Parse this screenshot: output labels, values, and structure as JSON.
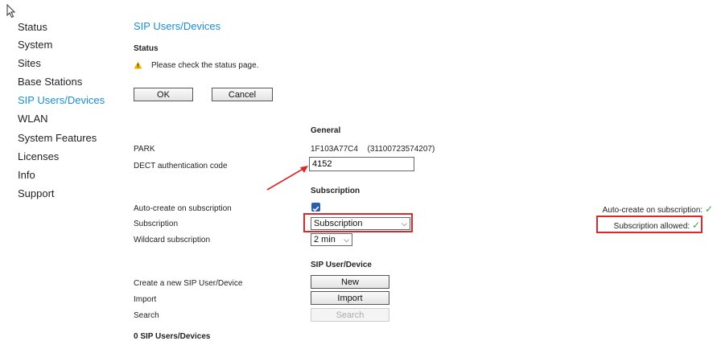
{
  "nav": {
    "items": [
      {
        "label": "Status"
      },
      {
        "label": "System"
      },
      {
        "label": "Sites"
      },
      {
        "label": "Base Stations"
      },
      {
        "label": "SIP Users/Devices"
      },
      {
        "label": "WLAN"
      },
      {
        "label": "System Features"
      },
      {
        "label": "Licenses"
      },
      {
        "label": "Info"
      },
      {
        "label": "Support"
      }
    ]
  },
  "page": {
    "title": "SIP Users/Devices",
    "status_heading": "Status",
    "status_message": "Please check the status page.",
    "ok_label": "OK",
    "cancel_label": "Cancel"
  },
  "general": {
    "heading": "General",
    "park_label": "PARK",
    "park_value": "1F103A77C4",
    "park_number": "(31100723574207)",
    "dect_label": "DECT authentication code",
    "dect_value": "4152"
  },
  "subscription": {
    "heading": "Subscription",
    "auto_create_label": "Auto-create on subscription",
    "auto_create_checked": true,
    "subscription_label": "Subscription",
    "subscription_value": "Subscription",
    "wildcard_label": "Wildcard subscription",
    "wildcard_value": "2 min",
    "status_auto_create": "Auto-create on subscription:",
    "status_allowed": "Subscription allowed:"
  },
  "sip": {
    "heading": "SIP User/Device",
    "create_label": "Create a new SIP User/Device",
    "new_button": "New",
    "import_label": "Import",
    "import_button": "Import",
    "search_label": "Search",
    "search_button": "Search",
    "count_text": "0 SIP Users/Devices"
  },
  "colors": {
    "link_active": "#1a8ed1",
    "title": "#1a8ed1",
    "highlight": "#d9292b",
    "ok_check": "#3aa53a",
    "warning": "#f0b400"
  }
}
